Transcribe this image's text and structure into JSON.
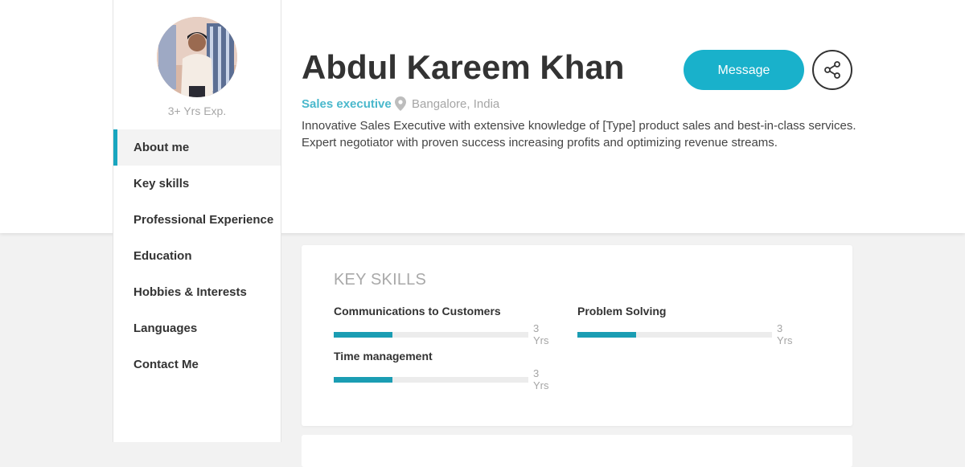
{
  "profile": {
    "experience": "3+ Yrs Exp.",
    "name": "Abdul Kareem Khan",
    "role": "Sales executive",
    "location": "Bangalore, India",
    "bio_line1": "Innovative Sales Executive with extensive knowledge of [Type] product sales and best-in-class services.",
    "bio_line2": "Expert negotiator with proven success increasing profits and optimizing revenue streams.",
    "avatar_icon": "user-photo"
  },
  "actions": {
    "message_label": "Message",
    "share_icon": "share-icon"
  },
  "nav": {
    "items": [
      {
        "label": "About me",
        "active": true
      },
      {
        "label": "Key skills",
        "active": false
      },
      {
        "label": "Professional Experience",
        "active": false
      },
      {
        "label": "Education",
        "active": false
      },
      {
        "label": "Hobbies & Interests",
        "active": false
      },
      {
        "label": "Languages",
        "active": false
      },
      {
        "label": "Contact Me",
        "active": false
      }
    ]
  },
  "key_skills": {
    "title": "KEY SKILLS",
    "skills": [
      {
        "name": "Communications to Customers",
        "years": "3 Yrs",
        "level": 0.3
      },
      {
        "name": "Problem Solving",
        "years": "3 Yrs",
        "level": 0.3
      },
      {
        "name": "Time management",
        "years": "3 Yrs",
        "level": 0.3
      }
    ]
  },
  "colors": {
    "accent": "#19b1cb",
    "bar_fill": "#1a9db3",
    "role_text": "#4ab8cc"
  }
}
